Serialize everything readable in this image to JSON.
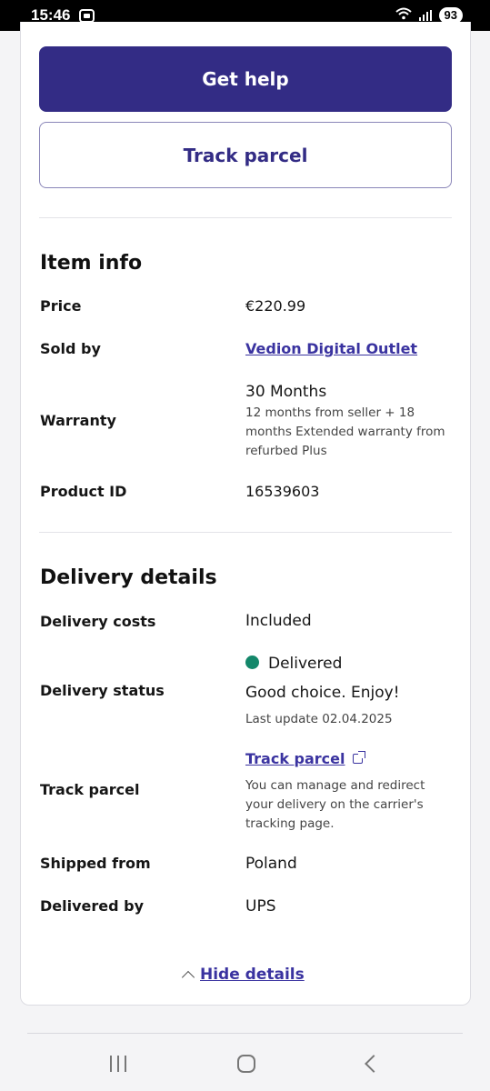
{
  "status_bar": {
    "time": "15:46",
    "battery": "93"
  },
  "actions": {
    "get_help": "Get help",
    "track_parcel": "Track parcel"
  },
  "item_info": {
    "title": "Item info",
    "price_label": "Price",
    "price_value": "€220.99",
    "sold_by_label": "Sold by",
    "sold_by_value": "Vedion Digital Outlet",
    "warranty_label": "Warranty",
    "warranty_value": "30 Months",
    "warranty_detail": "12 months from seller + 18 months Extended warranty from refurbed Plus",
    "product_id_label": "Product ID",
    "product_id_value": "16539603"
  },
  "delivery": {
    "title": "Delivery details",
    "costs_label": "Delivery costs",
    "costs_value": "Included",
    "status_label": "Delivery status",
    "status_value": "Delivered",
    "status_message": "Good choice. Enjoy!",
    "status_updated": "Last update 02.04.2025",
    "status_color": "#13876a",
    "track_label": "Track parcel",
    "track_link": "Track parcel",
    "track_help": "You can manage and redirect your delivery on the carrier's tracking page.",
    "shipped_from_label": "Shipped from",
    "shipped_from_value": "Poland",
    "delivered_by_label": "Delivered by",
    "delivered_by_value": "UPS"
  },
  "hide_details": "Hide details",
  "colors": {
    "primary": "#332c85",
    "link": "#3a33a0"
  }
}
